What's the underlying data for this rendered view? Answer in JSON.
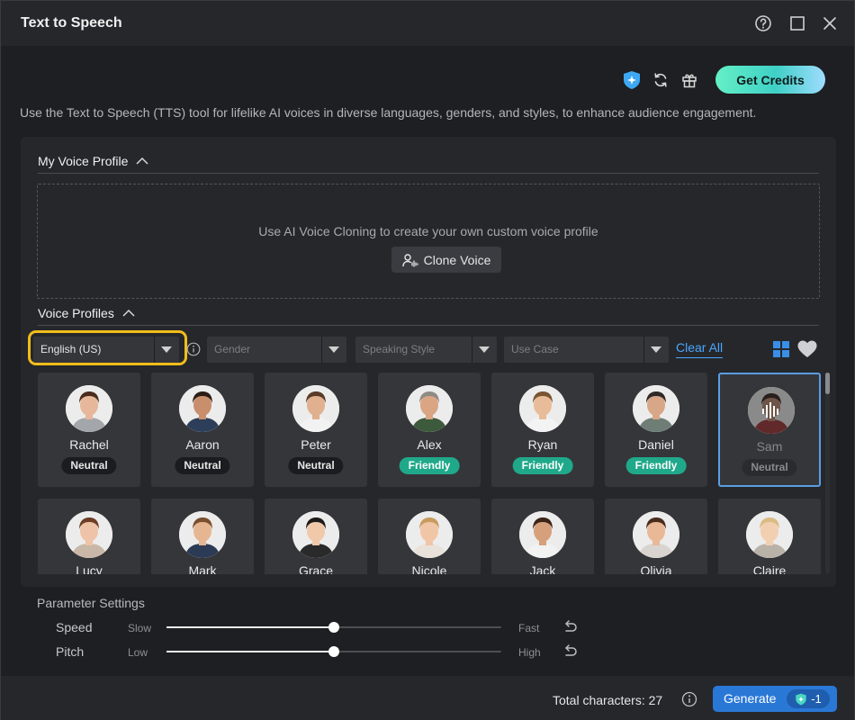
{
  "window": {
    "title": "Text to Speech"
  },
  "topbar": {
    "get_credits_label": "Get Credits"
  },
  "description": "Use the Text to Speech (TTS) tool for lifelike AI voices in diverse languages, genders, and styles, to enhance audience engagement.",
  "my_voice_profile": {
    "title": "My Voice Profile",
    "prompt": "Use AI Voice Cloning to create your own custom voice profile",
    "clone_button": "Clone Voice"
  },
  "voice_profiles": {
    "title": "Voice Profiles",
    "filters": {
      "language": "English (US)",
      "gender_placeholder": "Gender",
      "style_placeholder": "Speaking Style",
      "use_case_placeholder": "Use Case",
      "clear_all": "Clear All"
    },
    "voices": [
      {
        "name": "Rachel",
        "tag": "Neutral",
        "tag_type": "neutral",
        "skin": "#e6b79b",
        "hair": "#4a2c1d",
        "shirt": "#a3a7ac"
      },
      {
        "name": "Aaron",
        "tag": "Neutral",
        "tag_type": "neutral",
        "skin": "#c98f6c",
        "hair": "#2b1d15",
        "shirt": "#2c3e5a"
      },
      {
        "name": "Peter",
        "tag": "Neutral",
        "tag_type": "neutral",
        "skin": "#e0b08f",
        "hair": "#5a3b27",
        "shirt": "#f2f2f2"
      },
      {
        "name": "Alex",
        "tag": "Friendly",
        "tag_type": "friendly",
        "skin": "#d9a583",
        "hair": "#8e8a86",
        "shirt": "#3d5a3c"
      },
      {
        "name": "Ryan",
        "tag": "Friendly",
        "tag_type": "friendly",
        "skin": "#e8bc98",
        "hair": "#7a5532",
        "shirt": "#f3f3f3"
      },
      {
        "name": "Daniel",
        "tag": "Friendly",
        "tag_type": "friendly",
        "skin": "#d8a787",
        "hair": "#2f2a27",
        "shirt": "#6e7e77"
      },
      {
        "name": "Sam",
        "tag": "Neutral",
        "tag_type": "neutral",
        "skin": "#b98b72",
        "hair": "#3a2a22",
        "shirt": "#a33b3b",
        "selected": true
      },
      {
        "name": "Lucy",
        "tag": "",
        "tag_type": "",
        "skin": "#efc3a7",
        "hair": "#6b3e25",
        "shirt": "#c9b8a7"
      },
      {
        "name": "Mark",
        "tag": "",
        "tag_type": "",
        "skin": "#e6b693",
        "hair": "#7a4f2e",
        "shirt": "#2b3a55"
      },
      {
        "name": "Grace",
        "tag": "",
        "tag_type": "",
        "skin": "#f0c9aa",
        "hair": "#1e1a18",
        "shirt": "#2a2a2a"
      },
      {
        "name": "Nicole",
        "tag": "",
        "tag_type": "",
        "skin": "#f1c6a6",
        "hair": "#c89a5e",
        "shirt": "#e9e2da"
      },
      {
        "name": "Jack",
        "tag": "",
        "tag_type": "",
        "skin": "#d7a07c",
        "hair": "#3a2418",
        "shirt": "#f2f2f2"
      },
      {
        "name": "Olivia",
        "tag": "",
        "tag_type": "",
        "skin": "#e9b897",
        "hair": "#4a2c1c",
        "shirt": "#d9d4cf"
      },
      {
        "name": "Claire",
        "tag": "",
        "tag_type": "",
        "skin": "#f3cfb1",
        "hair": "#d9bb83",
        "shirt": "#b9b2a8"
      }
    ]
  },
  "parameters": {
    "title": "Parameter Settings",
    "speed": {
      "label": "Speed",
      "min_label": "Slow",
      "max_label": "Fast",
      "value": 0.5
    },
    "pitch": {
      "label": "Pitch",
      "min_label": "Low",
      "max_label": "High",
      "value": 0.5
    }
  },
  "footer": {
    "total_characters": "Total characters: 27",
    "generate_label": "Generate",
    "generate_cost": "-1"
  },
  "colors": {
    "accent": "#2a78d6",
    "highlight": "#f2bd1b",
    "friendly": "#1fa98a",
    "link": "#4aa7ff"
  }
}
